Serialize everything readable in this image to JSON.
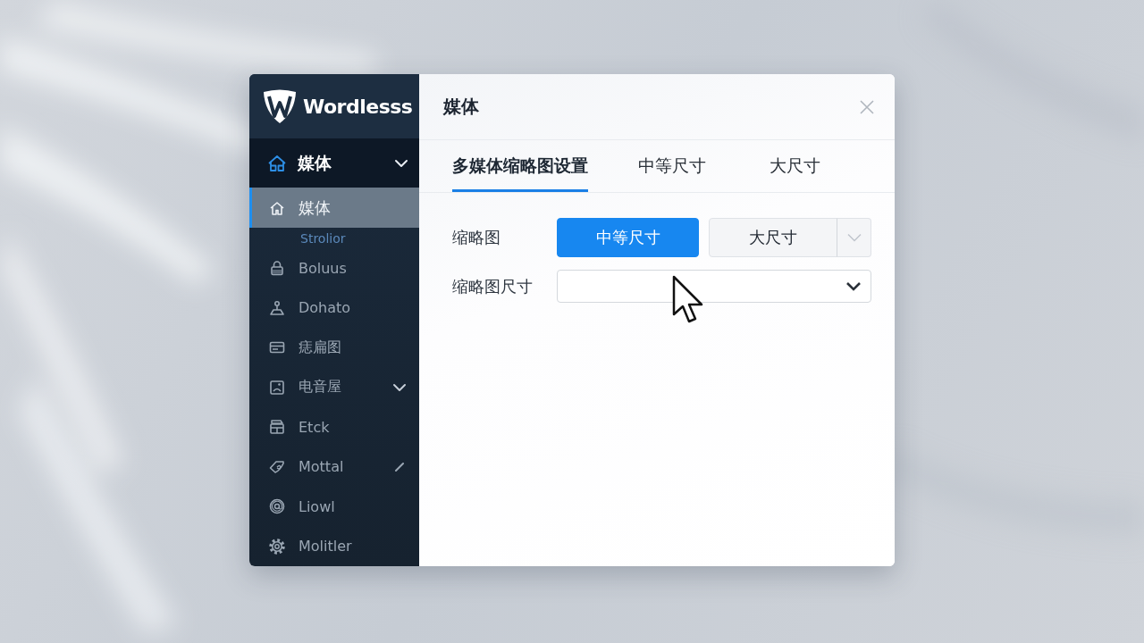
{
  "sidebar": {
    "logo": "Wordlesss",
    "group": {
      "label": "媒体",
      "expanded": true
    },
    "items": [
      {
        "kind": "plain",
        "label": "媒体",
        "selected": true,
        "caption": "Strolior"
      },
      {
        "kind": "plain",
        "label": "Boluus",
        "selected": false
      },
      {
        "kind": "plain",
        "label": "Dohato",
        "selected": false
      },
      {
        "kind": "plain",
        "label": "痣扁图",
        "selected": false
      },
      {
        "kind": "expandable",
        "label": "电音屋",
        "selected": false
      },
      {
        "kind": "plain",
        "label": "Etck",
        "selected": false
      },
      {
        "kind": "marked",
        "label": "Mottal",
        "selected": false
      },
      {
        "kind": "plain",
        "label": "Liowl",
        "selected": false
      },
      {
        "kind": "plain",
        "label": "Molitler",
        "selected": false
      }
    ]
  },
  "dialog": {
    "title": "媒体",
    "tabs": [
      {
        "label": "多媒体缩略图设置",
        "selected": true
      },
      {
        "label": "中等尺寸",
        "selected": false
      },
      {
        "label": "大尺寸",
        "selected": false
      }
    ],
    "form": [
      {
        "kind": "segmented",
        "label": "缩略图",
        "options": [
          {
            "label": "中等尺寸",
            "selected": true
          },
          {
            "label": "大尺寸",
            "selected": false
          }
        ]
      },
      {
        "kind": "select",
        "label": "缩略图尺寸"
      }
    ]
  }
}
